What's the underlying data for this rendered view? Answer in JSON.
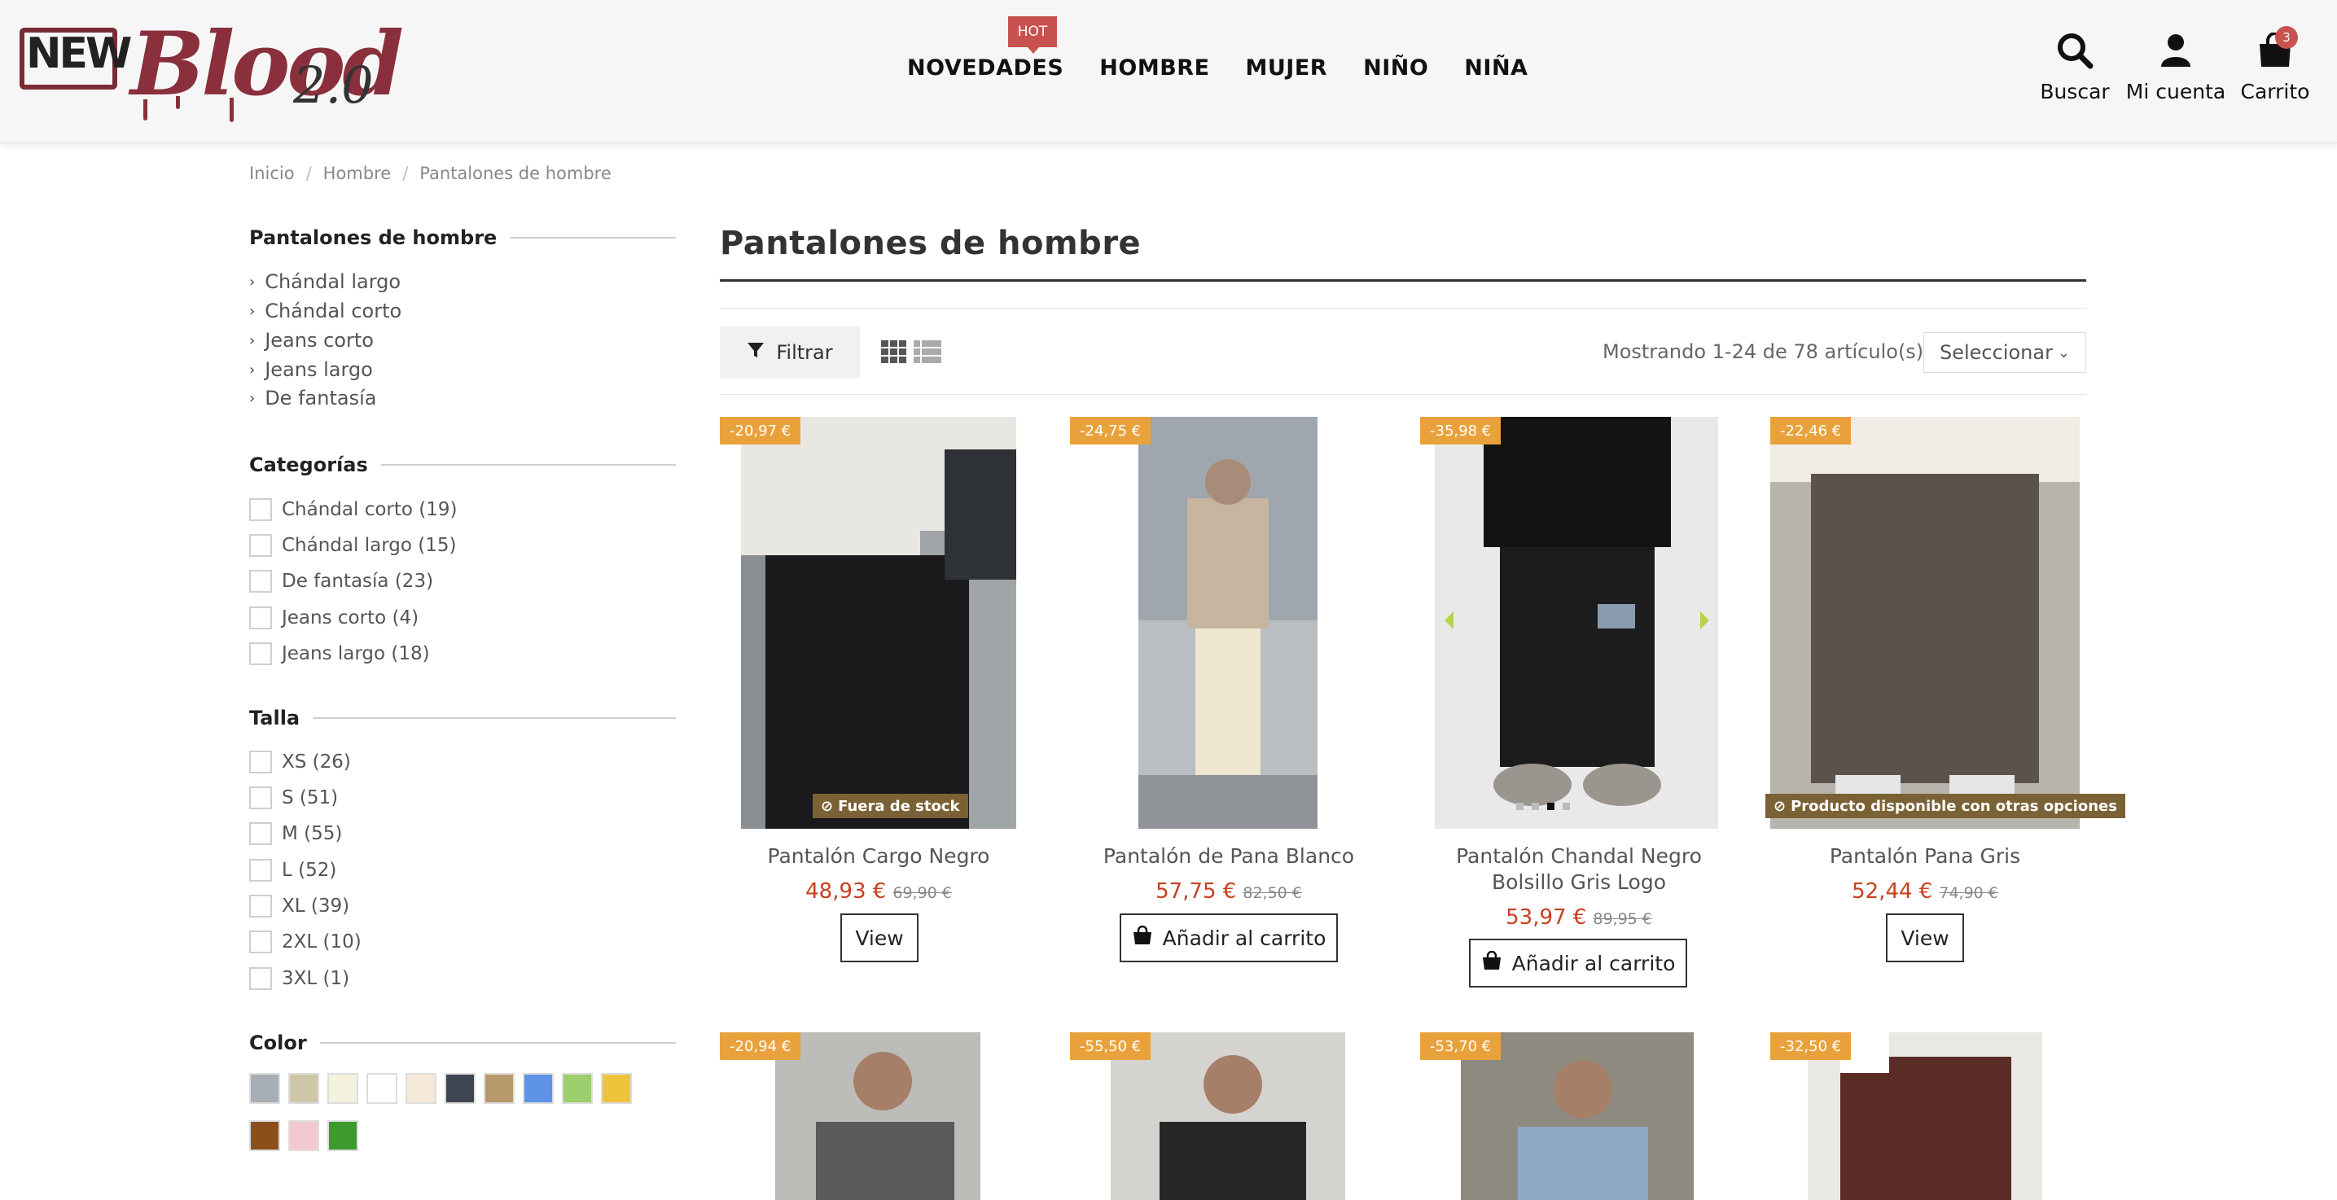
{
  "header": {
    "logo_alt": "NEW Blood 2.0",
    "logo_new": "NEW",
    "logo_blood": "Blood",
    "logo_version": "2.0",
    "hot_badge": "HOT",
    "nav": [
      "NOVEDADES",
      "HOMBRE",
      "MUJER",
      "NIÑO",
      "NIÑA"
    ],
    "actions": {
      "search": "Buscar",
      "account": "Mi cuenta",
      "cart": "Carrito",
      "cart_count": "3"
    }
  },
  "breadcrumb": [
    "Inicio",
    "Hombre",
    "Pantalones de hombre"
  ],
  "sidebar": {
    "category_title": "Pantalones de hombre",
    "subcategories": [
      "Chándal largo",
      "Chándal corto",
      "Jeans corto",
      "Jeans largo",
      "De fantasía"
    ],
    "categorias_title": "Categorías",
    "categorias": [
      "Chándal corto (19)",
      "Chándal largo (15)",
      "De fantasía (23)",
      "Jeans corto (4)",
      "Jeans largo (18)"
    ],
    "talla_title": "Talla",
    "tallas": [
      "XS (26)",
      "S (51)",
      "M (55)",
      "L (52)",
      "XL (39)",
      "2XL (10)",
      "3XL (1)"
    ],
    "color_title": "Color",
    "colors": [
      "#a7aeb6",
      "#cfc6a8",
      "#f4f1dc",
      "#ffffff",
      "#f6e8d8",
      "#3d4452",
      "#b79a6c",
      "#5f93e6",
      "#9bcf6b",
      "#ecc33b",
      "#8c4e1a",
      "#f3c8cf",
      "#3e9a2c"
    ]
  },
  "main": {
    "title": "Pantalones de hombre",
    "filter_label": "Filtrar",
    "showing": "Mostrando 1-24 de 78 artículo(s)",
    "sort_label": "Seleccionar"
  },
  "products": [
    {
      "name": "Pantalón Cargo Negro",
      "price": "48,93 €",
      "old_price": "69,90 €",
      "discount": "-20,97 €",
      "button": "View",
      "flag": "Fuera de stock"
    },
    {
      "name": "Pantalón de Pana Blanco",
      "price": "57,75 €",
      "old_price": "82,50 €",
      "discount": "-24,75 €",
      "button": "Añadir al carrito",
      "flag": ""
    },
    {
      "name_line1": "Pantalón Chandal Negro",
      "name_line2": "Bolsillo Gris Logo",
      "price": "53,97 €",
      "old_price": "89,95 €",
      "discount": "-35,98 €",
      "button": "Añadir al carrito",
      "flag": ""
    },
    {
      "name": "Pantalón Pana Gris",
      "price": "52,44 €",
      "old_price": "74,90 €",
      "discount": "-22,46 €",
      "button": "View",
      "flag": "Producto disponible con otras opciones"
    }
  ],
  "products_row2": [
    {
      "discount": "-20,94 €"
    },
    {
      "discount": "-55,50 €"
    },
    {
      "discount": "-53,70 €"
    },
    {
      "discount": "-32,50 €"
    }
  ]
}
